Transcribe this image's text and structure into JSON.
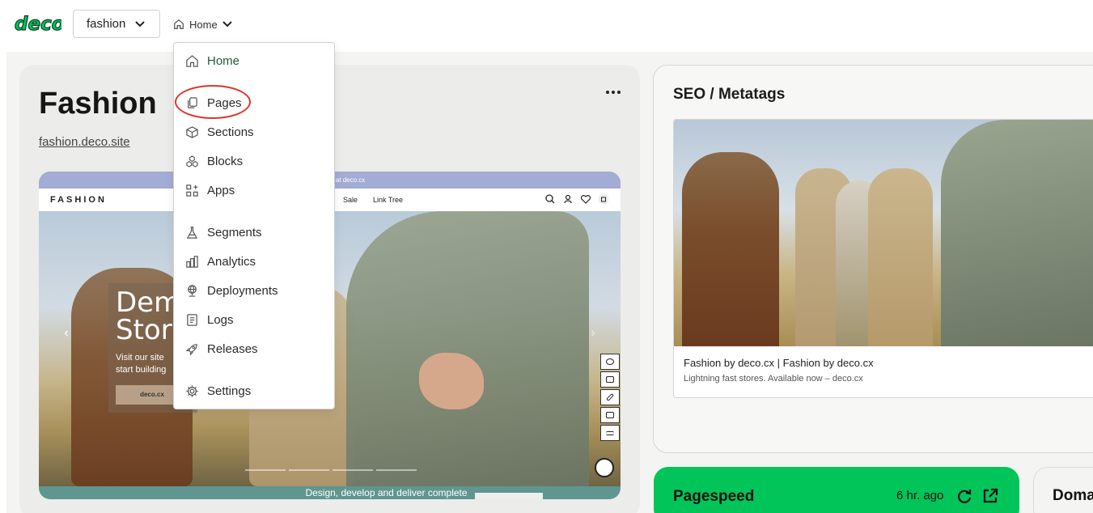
{
  "topbar": {
    "logo_text": "deco",
    "site_selector": "fashion",
    "breadcrumb": "Home"
  },
  "menu": {
    "items": [
      {
        "label": "Home",
        "icon": "home-icon"
      },
      {
        "label": "Pages",
        "icon": "pages-icon"
      },
      {
        "label": "Sections",
        "icon": "cube-icon"
      },
      {
        "label": "Blocks",
        "icon": "blocks-icon"
      },
      {
        "label": "Apps",
        "icon": "apps-icon"
      },
      {
        "label": "Segments",
        "icon": "flask-icon"
      },
      {
        "label": "Analytics",
        "icon": "bar-chart-icon"
      },
      {
        "label": "Deployments",
        "icon": "globe-icon"
      },
      {
        "label": "Logs",
        "icon": "logs-icon"
      },
      {
        "label": "Releases",
        "icon": "rocket-icon"
      },
      {
        "label": "Settings",
        "icon": "gear-icon"
      }
    ]
  },
  "site": {
    "title": "Fashion",
    "url": "fashion.deco.site"
  },
  "preview": {
    "banner": "...o your store at deco.cx",
    "logo": "FASHION",
    "nav_links": [
      "Sale",
      "Link Tree"
    ],
    "hero_heading_1": "Dem",
    "hero_heading_2": "Stor",
    "hero_text_1": "Visit our site",
    "hero_text_2": "start building",
    "hero_button": "deco.cx",
    "footer_text": "Design, develop and deliver complete"
  },
  "seo": {
    "title": "SEO / Metatags",
    "page_title": "Fashion by deco.cx | Fashion by deco.cx",
    "description": "Lightning fast stores. Available now – deco.cx"
  },
  "pagespeed": {
    "title": "Pagespeed",
    "time": "6 hr. ago"
  },
  "domains": {
    "title": "Doma"
  },
  "colors": {
    "brand_green": "#02c559",
    "active_menu": "#1f5c36",
    "highlight": "#d9362b"
  }
}
